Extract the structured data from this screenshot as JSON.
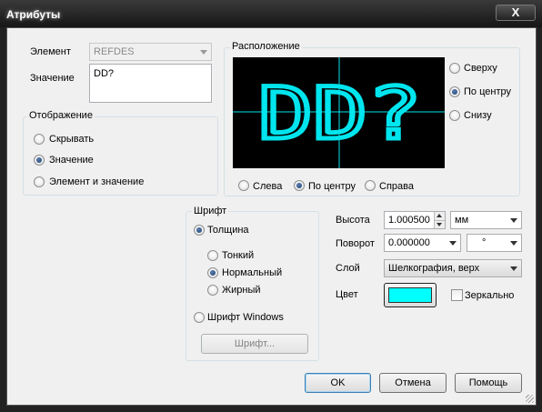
{
  "window": {
    "title": "Атрибуты",
    "close_glyph": "X"
  },
  "element": {
    "label": "Элемент",
    "value": "REFDES"
  },
  "value_field": {
    "label": "Значение",
    "text": "DD?"
  },
  "display": {
    "title": "Отображение",
    "options": [
      {
        "label": "Скрывать",
        "selected": false
      },
      {
        "label": "Значение",
        "selected": true
      },
      {
        "label": "Элемент и значение",
        "selected": false
      }
    ]
  },
  "position": {
    "title": "Расположение",
    "preview_text": "DD?",
    "preview_color": "#00e5ee",
    "vertical": [
      {
        "label": "Сверху",
        "selected": false
      },
      {
        "label": "По центру",
        "selected": true
      },
      {
        "label": "Снизу",
        "selected": false
      }
    ],
    "horizontal": [
      {
        "label": "Слева",
        "selected": false
      },
      {
        "label": "По центру",
        "selected": true
      },
      {
        "label": "Справа",
        "selected": false
      }
    ]
  },
  "font": {
    "title": "Шрифт",
    "thickness_label": "Толщина",
    "thickness_selected": true,
    "weights": [
      {
        "label": "Тонкий",
        "selected": false
      },
      {
        "label": "Нормальный",
        "selected": true
      },
      {
        "label": "Жирный",
        "selected": false
      }
    ],
    "windows_font_label": "Шрифт Windows",
    "font_button": "Шрифт..."
  },
  "props": {
    "height_label": "Высота",
    "height_value": "1.000500",
    "height_unit": "мм",
    "rotation_label": "Поворот",
    "rotation_value": "0.000000",
    "rotation_unit": "°",
    "layer_label": "Слой",
    "layer_value": "Шелкография, верх",
    "color_label": "Цвет",
    "color_value": "#00ffff",
    "mirror_label": "Зеркально",
    "mirror_checked": false
  },
  "buttons": {
    "ok": "OK",
    "cancel": "Отмена",
    "help": "Помощь"
  }
}
